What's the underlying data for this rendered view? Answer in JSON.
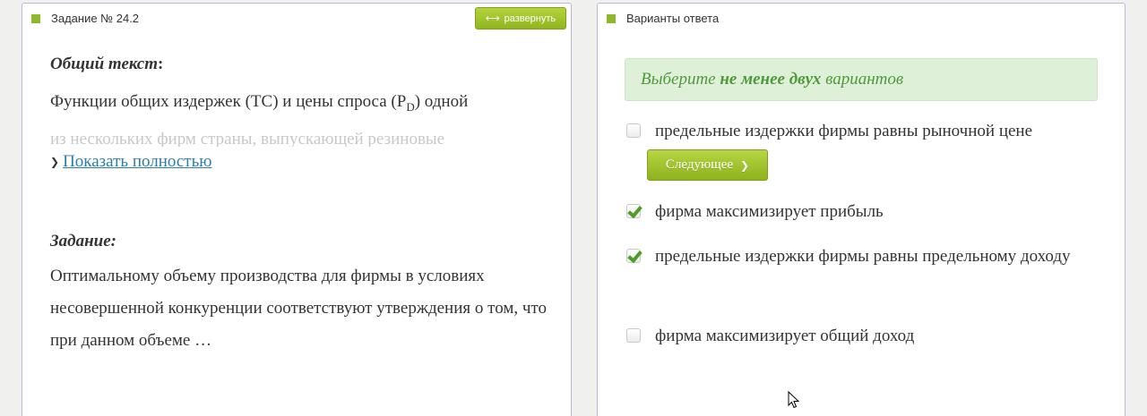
{
  "left_panel": {
    "header_title": "Задание № 24.2",
    "expand_button": "развернуть",
    "general_text_label": "Общий текст",
    "general_text_colon": ":",
    "general_text_line1_a": "Функции общих издержек (ТС) и цены спроса (P",
    "general_text_line1_sub": "D",
    "general_text_line1_b": ") одной",
    "general_text_line2": "из нескольких фирм страны, выпускающей резиновые",
    "show_more": " Показать полностью",
    "task_label": "Задание:",
    "task_text": "Оптимальному объему производства для фирмы в условиях несовершенной конкуренции соответствуют утверждения о том, что при данном объеме …"
  },
  "right_panel": {
    "header_title": "Варианты ответа",
    "hint_prefix": "Выберите ",
    "hint_bold": "не менее двух",
    "hint_suffix": " вариантов",
    "next_button": "Следующее",
    "options": [
      {
        "label": "предельные издержки фирмы равны рыночной цене",
        "checked": false
      },
      {
        "label": "фирма максимизирует прибыль",
        "checked": true
      },
      {
        "label": "предельные издержки фирмы равны предельному доходу",
        "checked": true
      },
      {
        "label": "фирма максимизирует общий доход",
        "checked": false
      }
    ]
  },
  "colors": {
    "accent_green": "#8cb82a",
    "link_blue": "#2a7fb0",
    "hint_bg": "#dff0d8",
    "hint_text": "#4e9a3b",
    "panel_border": "#b9b9d9"
  },
  "icons": [
    "square-bullet-icon",
    "expand-arrows-icon",
    "chevron-down-icon",
    "chevron-right-icon",
    "checkmark-icon",
    "mouse-cursor-icon"
  ]
}
